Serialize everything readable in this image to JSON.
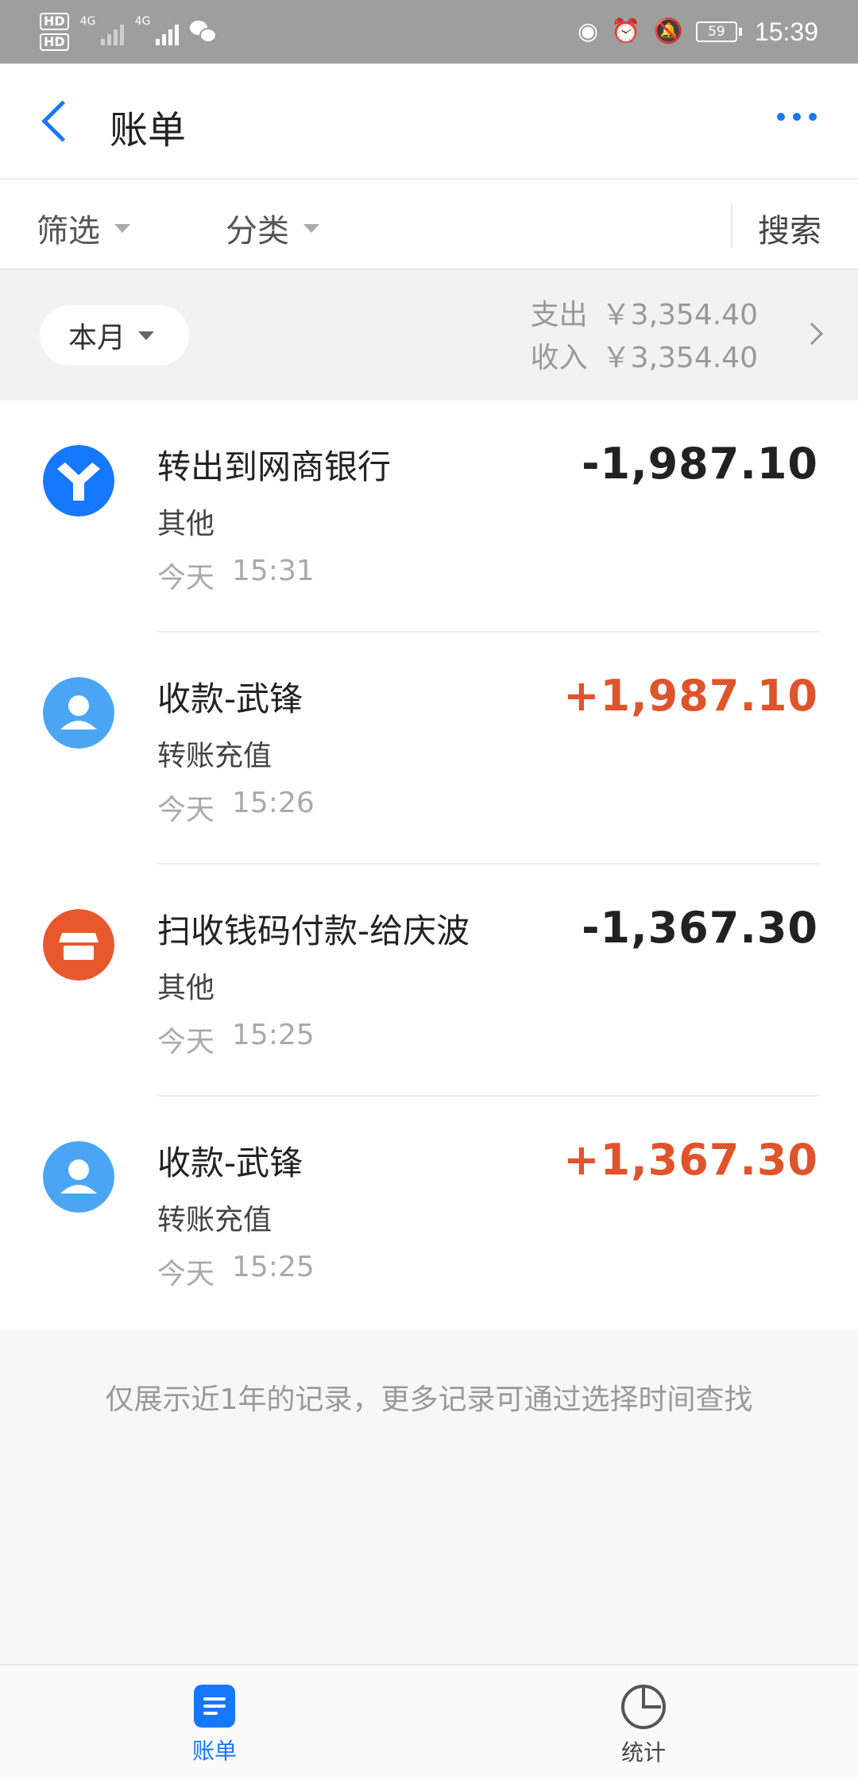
{
  "status_bar": {
    "hd1": "HD",
    "hd2": "HD",
    "sim1": "4G",
    "sim2": "4G",
    "battery": "59",
    "time": "15:39"
  },
  "header": {
    "title": "账单"
  },
  "filters": {
    "filter_label": "筛选",
    "category_label": "分类",
    "search_label": "搜索"
  },
  "summary": {
    "period": "本月",
    "expense_label": "支出",
    "expense_value": "￥3,354.40",
    "income_label": "收入",
    "income_value": "￥3,354.40"
  },
  "bills": [
    {
      "title": "转出到网商银行",
      "category": "其他",
      "day": "今天",
      "time": "15:31",
      "amount": "-1,987.10",
      "direction": "out",
      "icon": "mybank-logo-icon",
      "color": "#1677ff"
    },
    {
      "title": "收款-武锋",
      "category": "转账充值",
      "day": "今天",
      "time": "15:26",
      "amount": "+1,987.10",
      "direction": "in",
      "icon": "person-avatar-icon",
      "color": "#4aa6f5"
    },
    {
      "title": "扫收钱码付款-给庆波",
      "category": "其他",
      "day": "今天",
      "time": "15:25",
      "amount": "-1,367.30",
      "direction": "out",
      "icon": "store-icon",
      "color": "#e8582c"
    },
    {
      "title": "收款-武锋",
      "category": "转账充值",
      "day": "今天",
      "time": "15:25",
      "amount": "+1,367.30",
      "direction": "in",
      "icon": "person-avatar-icon",
      "color": "#4aa6f5"
    }
  ],
  "footer_note": "仅展示近1年的记录，更多记录可通过选择时间查找",
  "bottom_nav": {
    "bill_label": "账单",
    "stats_label": "统计",
    "active_color": "#1677ff"
  }
}
